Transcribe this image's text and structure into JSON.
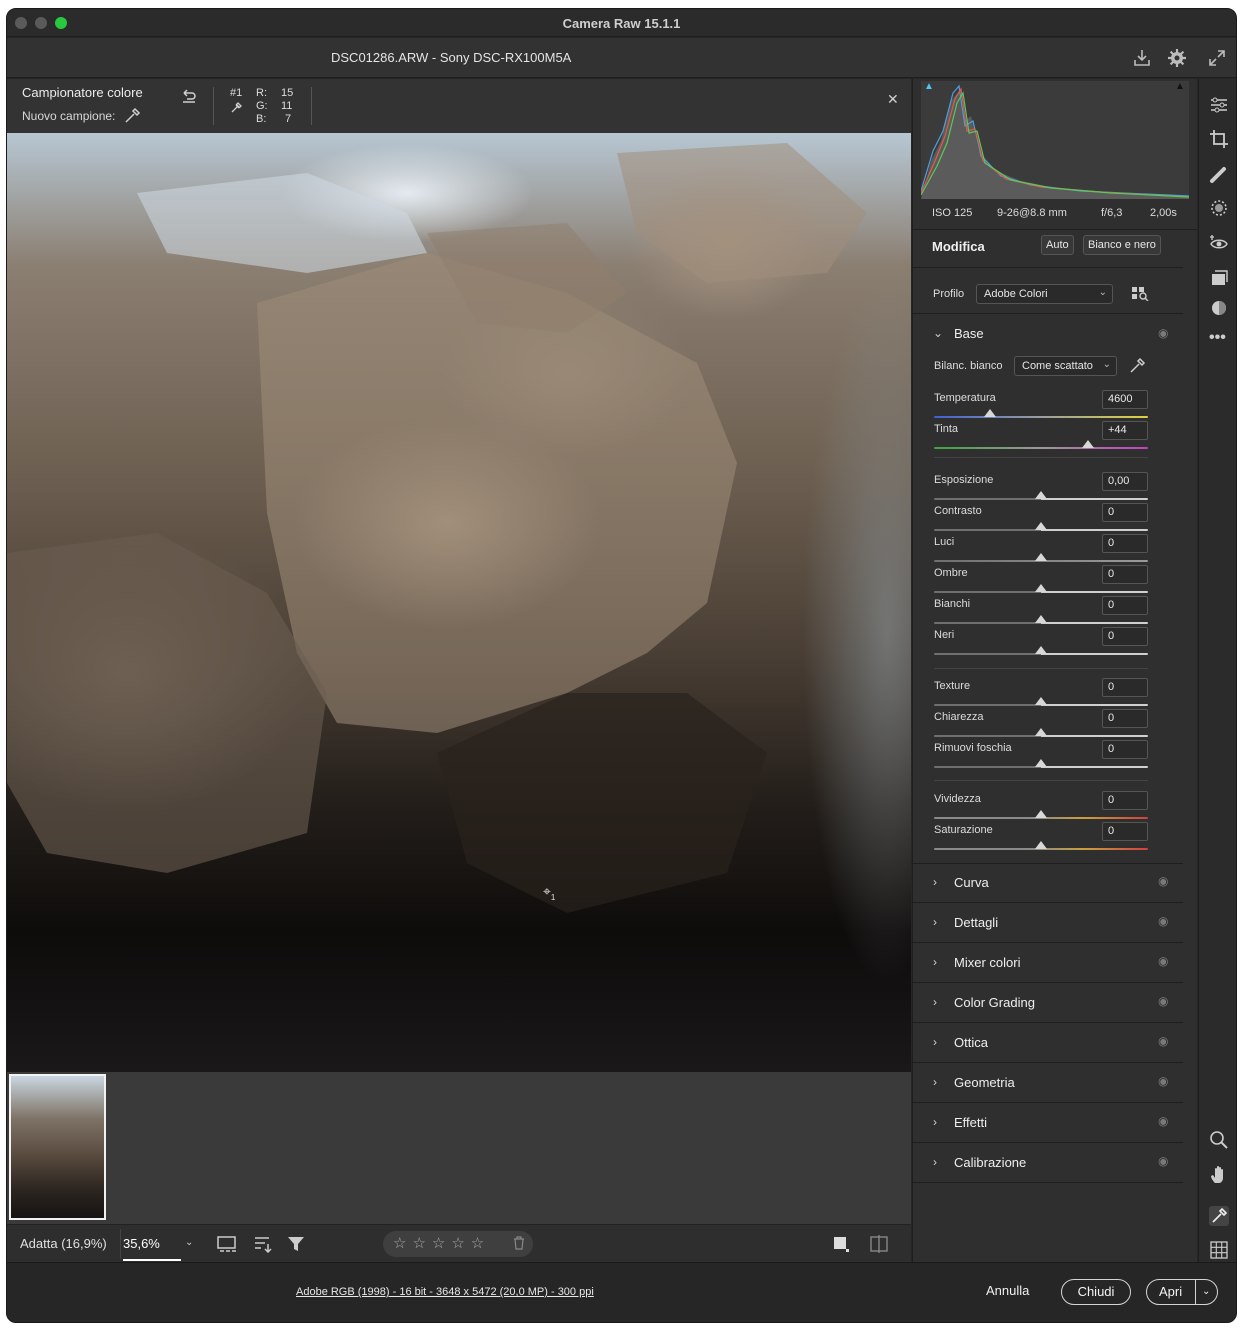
{
  "window": {
    "title": "Camera Raw 15.1.1"
  },
  "file": {
    "name_line": "DSC01286.ARW  -  Sony DSC-RX100M5A"
  },
  "sampler": {
    "title": "Campionatore colore",
    "new_sample_label": "Nuovo campione:",
    "sample_id": "#1",
    "r_label": "R:",
    "r_value": "15",
    "g_label": "G:",
    "g_value": "11",
    "b_label": "B:",
    "b_value": "7"
  },
  "histogram": {
    "iso": "ISO 125",
    "focal": "9-26@8.8 mm",
    "aperture": "f/6,3",
    "shutter": "2,00s"
  },
  "edit": {
    "title": "Modifica",
    "auto_label": "Auto",
    "bw_label": "Bianco e nero",
    "profile_label": "Profilo",
    "profile_value": "Adobe Colori"
  },
  "base": {
    "title": "Base",
    "wb_label": "Bilanc. bianco",
    "wb_value": "Come scattato",
    "sliders": [
      {
        "label": "Temperatura",
        "value": "4600"
      },
      {
        "label": "Tinta",
        "value": "+44"
      },
      {
        "label": "Esposizione",
        "value": "0,00"
      },
      {
        "label": "Contrasto",
        "value": "0"
      },
      {
        "label": "Luci",
        "value": "0"
      },
      {
        "label": "Ombre",
        "value": "0"
      },
      {
        "label": "Bianchi",
        "value": "0"
      },
      {
        "label": "Neri",
        "value": "0"
      },
      {
        "label": "Texture",
        "value": "0"
      },
      {
        "label": "Chiarezza",
        "value": "0"
      },
      {
        "label": "Rimuovi foschia",
        "value": "0"
      },
      {
        "label": "Vividezza",
        "value": "0"
      },
      {
        "label": "Saturazione",
        "value": "0"
      }
    ]
  },
  "sections": [
    {
      "label": "Curva"
    },
    {
      "label": "Dettagli"
    },
    {
      "label": "Mixer colori"
    },
    {
      "label": "Color Grading"
    },
    {
      "label": "Ottica"
    },
    {
      "label": "Geometria"
    },
    {
      "label": "Effetti"
    },
    {
      "label": "Calibrazione"
    }
  ],
  "view": {
    "fit_label": "Adatta (16,9%)",
    "zoom_value": "35,6%"
  },
  "rating": {
    "stars": "☆☆☆☆☆"
  },
  "status": {
    "file_info": "Adobe RGB (1998) - 16 bit - 3648 x 5472 (20,0 MP) - 300 ppi",
    "cancel_label": "Annulla",
    "close_label": "Chiudi",
    "open_label": "Apri"
  },
  "colors": {
    "accent_close": "#ff5f57",
    "accent_min": "#febc2e",
    "accent_max": "#28c840",
    "histogram_blue": "#4aa0e0",
    "histogram_red": "#e05a4a",
    "histogram_green": "#5ac85a"
  }
}
